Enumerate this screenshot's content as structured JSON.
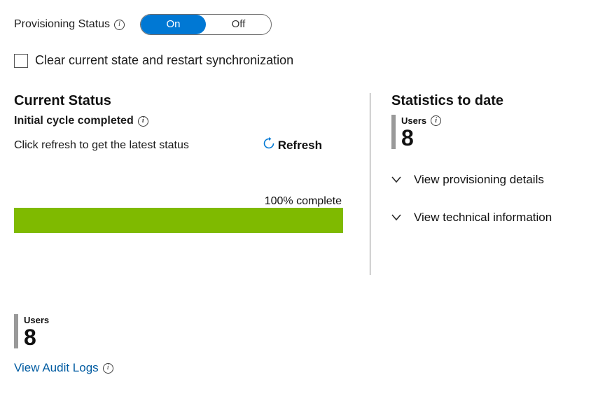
{
  "provisioning": {
    "label": "Provisioning Status",
    "on": "On",
    "off": "Off"
  },
  "clear_checkbox_label": "Clear current state and restart synchronization",
  "current_status": {
    "title": "Current Status",
    "subtitle": "Initial cycle completed",
    "hint": "Click refresh to get the latest status",
    "refresh_label": "Refresh",
    "progress_text": "100% complete"
  },
  "statistics": {
    "title": "Statistics to date",
    "users_label": "Users",
    "users_count": "8",
    "expand1": "View provisioning details",
    "expand2": "View technical information"
  },
  "bottom": {
    "users_label": "Users",
    "users_count": "8",
    "audit_link": "View Audit Logs"
  }
}
